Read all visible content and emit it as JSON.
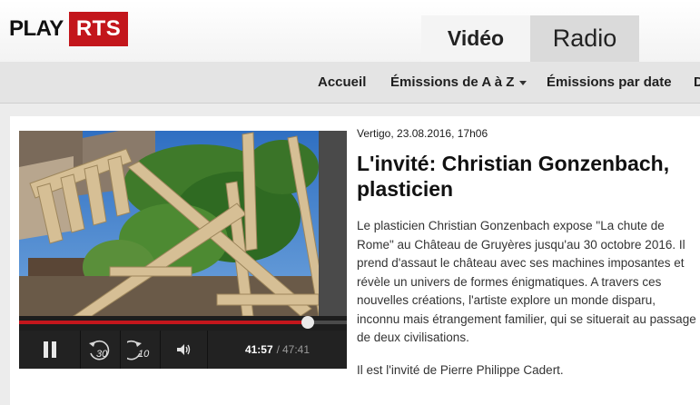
{
  "brand": {
    "play": "PLAY",
    "rts": "RTS"
  },
  "tabs": [
    {
      "label": "Vidéo"
    },
    {
      "label": "Radio"
    }
  ],
  "nav": {
    "items": [
      {
        "label": "Accueil"
      },
      {
        "label": "Émissions de A à Z"
      },
      {
        "label": "Émissions par date"
      },
      {
        "label": "D"
      }
    ]
  },
  "article": {
    "meta": "Vertigo, 23.08.2016, 17h06",
    "title": "L'invité: Christian Gonzenbach, plasticien",
    "description": "Le plasticien Christian Gonzenbach expose \"La chute de Rome\" au Château de Gruyères jusqu'au 30 octobre 2016. Il prend d'assaut le château avec ses machines imposantes et révèle un univers de formes énigmatiques. A travers ces nouvelles créations, l'artiste explore un monde disparu, inconnu mais étrangement familier, qui se situerait au passage de deux civilisations.",
    "guest_line": "Il est l'invité de Pierre Philippe Cadert."
  },
  "player": {
    "current_time": "41:57",
    "separator": "/",
    "duration": "47:41",
    "progress": 0.88,
    "rewind_label": "30",
    "forward_label": "10",
    "accent": "#c3161c"
  },
  "icons": {
    "pause": "pause-icon",
    "rewind": "rewind-30-icon",
    "forward": "forward-10-icon",
    "volume": "volume-icon"
  }
}
